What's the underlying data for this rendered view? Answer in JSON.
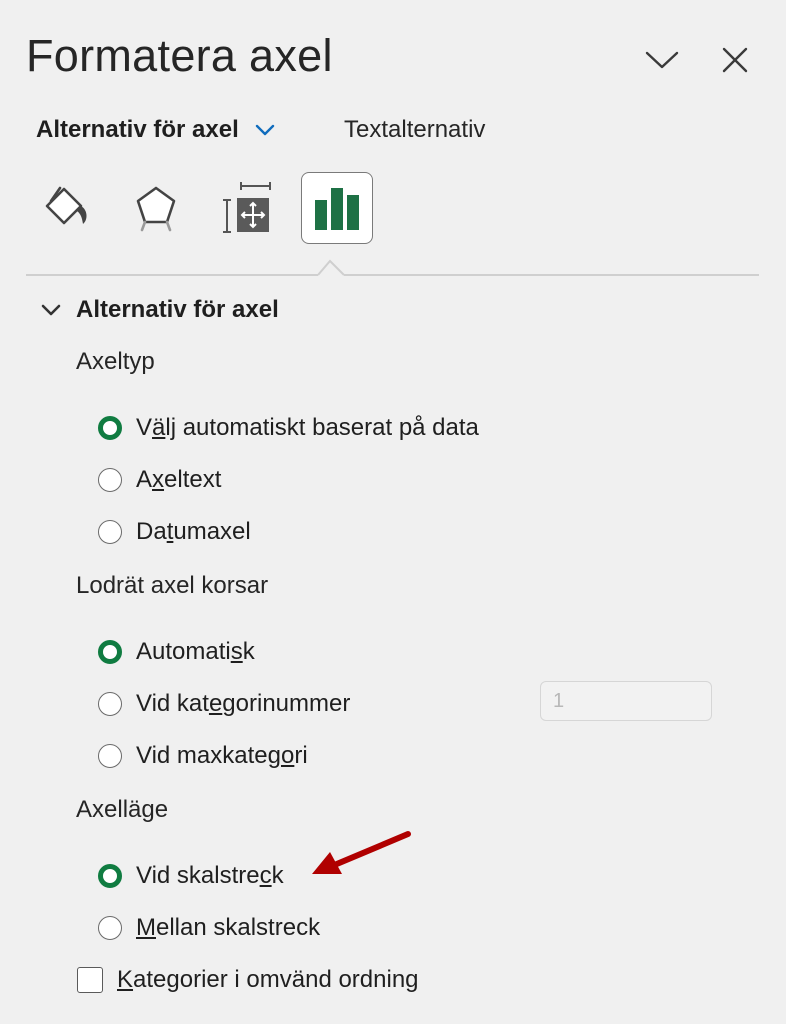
{
  "pane": {
    "title": "Formatera axel",
    "tabs": {
      "primary": "Alternativ för axel",
      "secondary": "Textalternativ"
    },
    "icons": [
      "paint-bucket-icon",
      "pentagon-icon",
      "size-properties-icon",
      "bar-chart-icon"
    ]
  },
  "section": {
    "title": "Alternativ för axel",
    "axis_type": {
      "label": "Axeltyp",
      "options": [
        {
          "pre": "V",
          "ul": "ä",
          "post": "lj automatiskt baserat på data",
          "selected": true
        },
        {
          "pre": "A",
          "ul": "x",
          "post": "eltext",
          "selected": false
        },
        {
          "pre": "Da",
          "ul": "t",
          "post": "umaxel",
          "selected": false
        }
      ]
    },
    "crosses": {
      "label": "Lodrät axel korsar",
      "options": [
        {
          "pre": "Automati",
          "ul": "s",
          "post": "k",
          "selected": true
        },
        {
          "pre": "Vid kat",
          "ul": "e",
          "post": "gorinummer",
          "selected": false
        },
        {
          "pre": "Vid maxkateg",
          "ul": "o",
          "post": "ri",
          "selected": false
        }
      ],
      "category_number_value": "1"
    },
    "position": {
      "label": "Axelläge",
      "options": [
        {
          "pre": "Vid skalstre",
          "ul": "c",
          "post": "k",
          "selected": true
        },
        {
          "pre": "",
          "ul": "M",
          "post": "ellan skalstreck",
          "selected": false
        }
      ]
    },
    "reverse": {
      "pre": "",
      "ul": "K",
      "post": "ategorier i omvänd ordning",
      "checked": false
    }
  },
  "colors": {
    "accent_green": "#107c41",
    "annotation_arrow": "#b00000",
    "chevron_blue": "#0f6cbd"
  }
}
